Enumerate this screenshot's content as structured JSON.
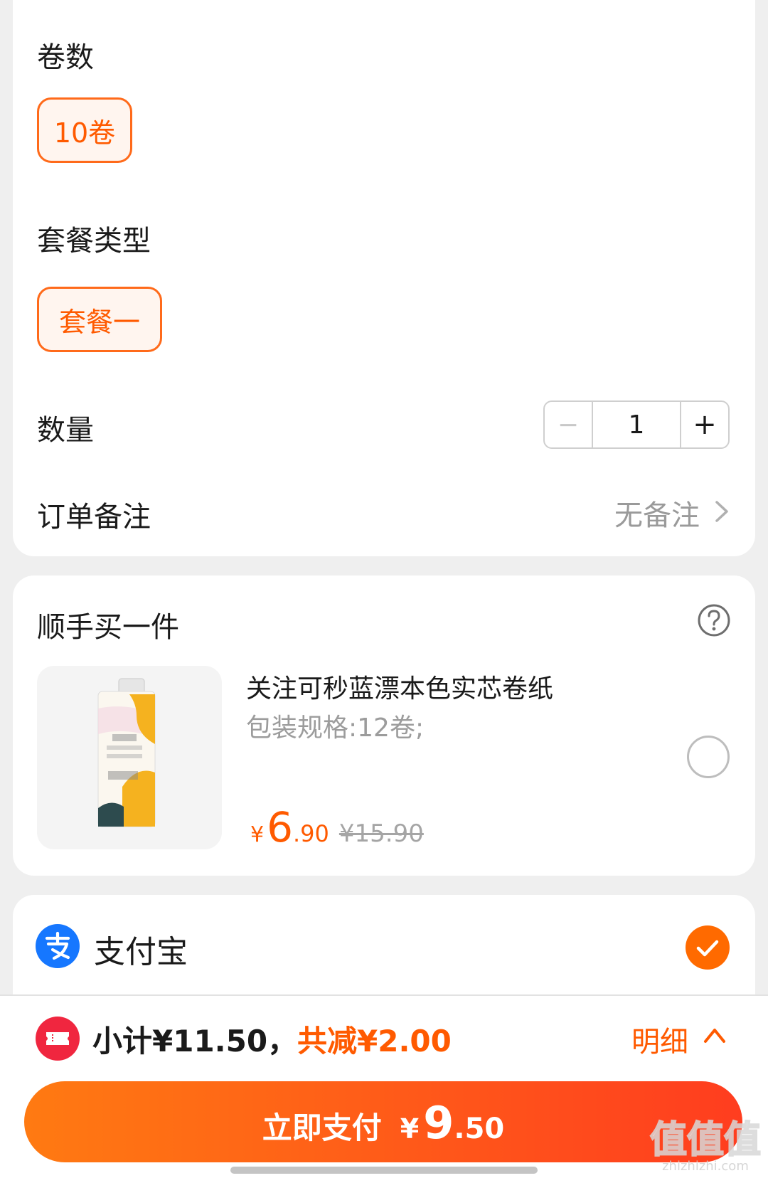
{
  "spec": {
    "rolls_title": "卷数",
    "rolls_option": "10卷",
    "package_title": "套餐类型",
    "package_option": "套餐一",
    "quantity_title": "数量",
    "quantity_value": "1",
    "minus_label": "−",
    "plus_label": "+",
    "remark_title": "订单备注",
    "remark_value": "无备注"
  },
  "addon": {
    "title": "顺手买一件",
    "product_name": "关注可秒蓝漂本色实芯卷纸",
    "product_spec": "包装规格:12卷;",
    "price_yen": "¥",
    "price_int": "6",
    "price_dec": ".90",
    "price_old": "¥15.90",
    "selected": false
  },
  "payment": {
    "method_label": "支付宝",
    "selected": true
  },
  "summary": {
    "subtotal": "小计¥11.50，",
    "discount": "共减¥2.00",
    "detail_label": "明细"
  },
  "pay_button": {
    "label": "立即支付",
    "yen": "¥",
    "int": "9",
    "dec": ".50"
  },
  "watermark": {
    "big": "值值值",
    "small": "zhizhizhi.com"
  },
  "colors": {
    "accent": "#ff5a00",
    "alipay_blue": "#1677ff",
    "background": "#efefef"
  }
}
